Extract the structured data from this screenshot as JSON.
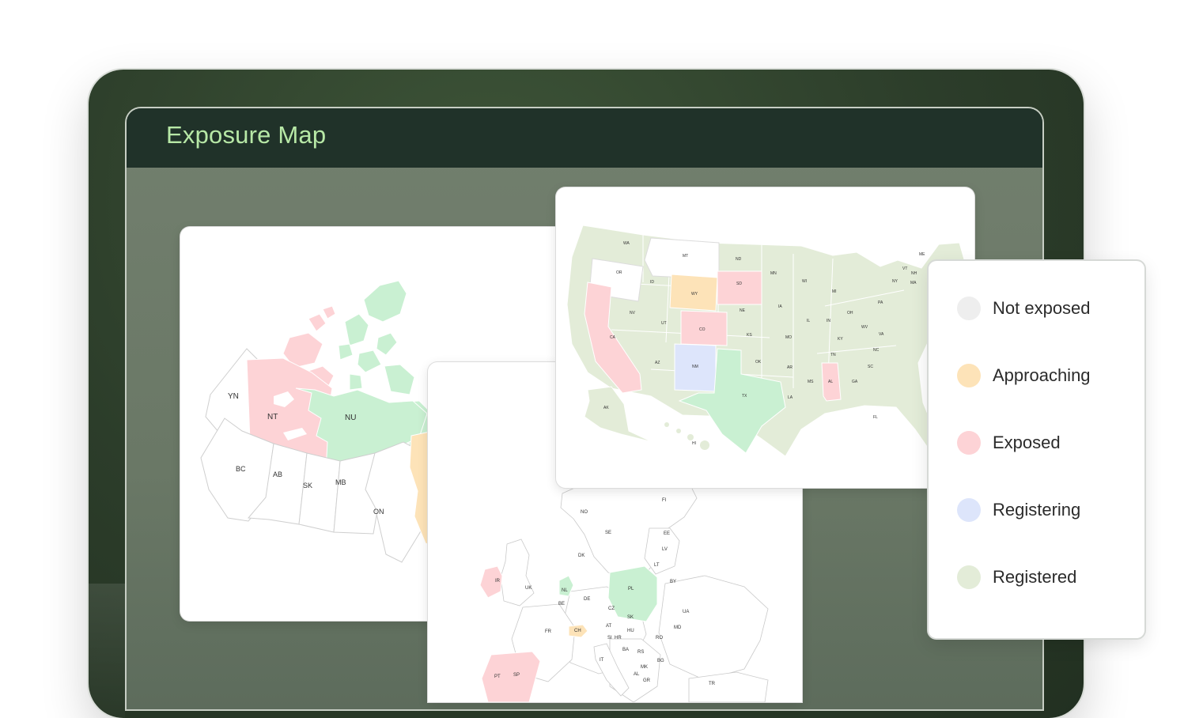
{
  "header": {
    "title": "Exposure Map"
  },
  "legend": [
    {
      "label": "Not exposed",
      "color": "#eeeeee"
    },
    {
      "label": "Approaching",
      "color": "#fde3b8"
    },
    {
      "label": "Exposed",
      "color": "#fdd3d6"
    },
    {
      "label": "Registering",
      "color": "#dde5fb"
    },
    {
      "label": "Registered",
      "color": "#e3ecd8"
    }
  ],
  "colors": {
    "not_exposed": "#ffffff",
    "approaching": "#fde3b8",
    "exposed": "#fdd3d6",
    "registering": "#dde5fb",
    "registered": "#e3ecd8",
    "highlight_green": "#c9f0d2"
  },
  "canada": {
    "regions": [
      "YN",
      "NT",
      "NU",
      "BC",
      "AB",
      "SK",
      "MB",
      "ON"
    ]
  },
  "usa": {
    "states": [
      "WA",
      "OR",
      "CA",
      "NV",
      "ID",
      "MT",
      "WY",
      "UT",
      "AZ",
      "CO",
      "NM",
      "ND",
      "SD",
      "NE",
      "KS",
      "OK",
      "TX",
      "MN",
      "IA",
      "MO",
      "AR",
      "LA",
      "WI",
      "IL",
      "MI",
      "IN",
      "OH",
      "KY",
      "TN",
      "MS",
      "AL",
      "GA",
      "FL",
      "SC",
      "NC",
      "VA",
      "WV",
      "PA",
      "NY",
      "VT",
      "NH",
      "MA",
      "ME",
      "AK",
      "HI"
    ]
  },
  "europe": {
    "countries": [
      "NO",
      "SE",
      "FI",
      "EE",
      "LV",
      "LT",
      "DK",
      "IR",
      "UK",
      "NL",
      "BE",
      "DE",
      "PL",
      "BY",
      "UA",
      "CZ",
      "SK",
      "FR",
      "CH",
      "AT",
      "HU",
      "SI",
      "HR",
      "BA",
      "RS",
      "RO",
      "MD",
      "IT",
      "BG",
      "MK",
      "AL",
      "GR",
      "SP",
      "PT",
      "TR"
    ]
  }
}
